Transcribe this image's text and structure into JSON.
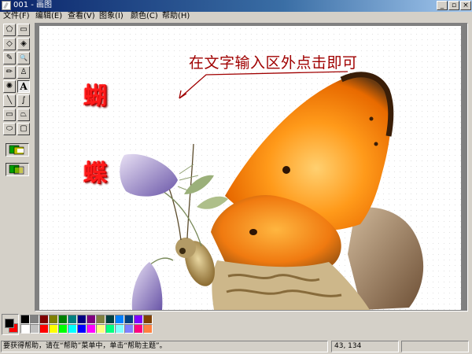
{
  "window": {
    "title": "001 - 画图",
    "controls": {
      "minimize": "_",
      "maximize": "▫",
      "close": "×"
    }
  },
  "menu": {
    "items": [
      "文件(F)",
      "编辑(E)",
      "查看(V)",
      "图象(I)",
      "颜色(C)",
      "帮助(H)"
    ]
  },
  "toolbox": {
    "tools": [
      {
        "name": "free-form-select-icon",
        "glyph": "⬠"
      },
      {
        "name": "select-icon",
        "glyph": "▭"
      },
      {
        "name": "eraser-icon",
        "glyph": "◇"
      },
      {
        "name": "fill-icon",
        "glyph": "◈"
      },
      {
        "name": "pick-color-icon",
        "glyph": "✎"
      },
      {
        "name": "magnifier-icon",
        "glyph": "🔍"
      },
      {
        "name": "pencil-icon",
        "glyph": "✏"
      },
      {
        "name": "brush-icon",
        "glyph": "♙"
      },
      {
        "name": "airbrush-icon",
        "glyph": "✺"
      },
      {
        "name": "text-icon",
        "glyph": "A"
      },
      {
        "name": "line-icon",
        "glyph": "╲"
      },
      {
        "name": "curve-icon",
        "glyph": "∫"
      },
      {
        "name": "rectangle-icon",
        "glyph": "▭"
      },
      {
        "name": "polygon-icon",
        "glyph": "⏢"
      },
      {
        "name": "ellipse-icon",
        "glyph": "⬭"
      },
      {
        "name": "rounded-rectangle-icon",
        "glyph": "▢"
      }
    ],
    "active_tool": "text-icon"
  },
  "canvas": {
    "callout_text": "在文字输入区外点击即可",
    "char_1": "蝴",
    "char_2": "蝶"
  },
  "palette": {
    "foreground": "#000000",
    "background": "#ff0000",
    "row1": [
      "#000000",
      "#808080",
      "#800000",
      "#808000",
      "#008000",
      "#008080",
      "#000080",
      "#800080",
      "#808040",
      "#004040",
      "#0080ff",
      "#004080",
      "#8000ff",
      "#804000"
    ],
    "row2": [
      "#ffffff",
      "#c0c0c0",
      "#ff0000",
      "#ffff00",
      "#00ff00",
      "#00ffff",
      "#0000ff",
      "#ff00ff",
      "#ffff80",
      "#00ff80",
      "#80ffff",
      "#8080ff",
      "#ff0080",
      "#ff8040"
    ]
  },
  "status": {
    "help_text": "要获得帮助，请在“帮助”菜单中，单击“帮助主题”。",
    "coords": "43, 134",
    "size": ""
  }
}
